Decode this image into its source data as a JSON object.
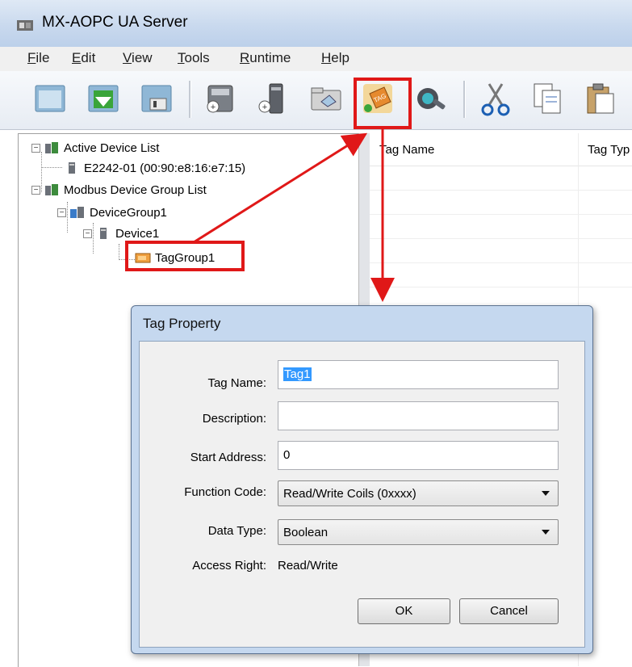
{
  "window": {
    "title": "MX-AOPC UA Server"
  },
  "menu": [
    {
      "label": "File",
      "accel": "F",
      "rest": "ile"
    },
    {
      "label": "Edit",
      "accel": "E",
      "rest": "dit"
    },
    {
      "label": "View",
      "accel": "V",
      "rest": "iew"
    },
    {
      "label": "Tools",
      "accel": "T",
      "rest": "ools"
    },
    {
      "label": "Runtime",
      "accel": "R",
      "rest": "untime"
    },
    {
      "label": "Help",
      "accel": "H",
      "rest": "elp"
    }
  ],
  "toolbar_icons": [
    "new-project-icon",
    "download-icon",
    "save-icon",
    "add-device-icon",
    "add-device-2-icon",
    "add-group-icon",
    "add-tag-icon",
    "settings-icon",
    "cut-icon",
    "copy-icon",
    "paste-icon"
  ],
  "tree": {
    "active_list": "Active Device List",
    "active_device": "E2242-01 (00:90:e8:16:e7:15)",
    "modbus_list": "Modbus Device Group List",
    "group": "DeviceGroup1",
    "device": "Device1",
    "tag_group": "TagGroup1"
  },
  "list": {
    "col_tag_name": "Tag Name",
    "col_tag_type": "Tag Typ"
  },
  "dialog": {
    "title": "Tag Property",
    "tag_name_label": "Tag Name:",
    "tag_name_value": "Tag1",
    "description_label": "Description:",
    "description_value": "",
    "start_address_label": "Start Address:",
    "start_address_value": "0",
    "function_code_label": "Function Code:",
    "function_code_value": "Read/Write Coils (0xxxx)",
    "data_type_label": "Data Type:",
    "data_type_value": "Boolean",
    "access_right_label": "Access Right:",
    "access_right_value": "Read/Write",
    "ok_label": "OK",
    "cancel_label": "Cancel"
  },
  "colors": {
    "highlight": "#e01818",
    "selection": "#3399ff"
  }
}
